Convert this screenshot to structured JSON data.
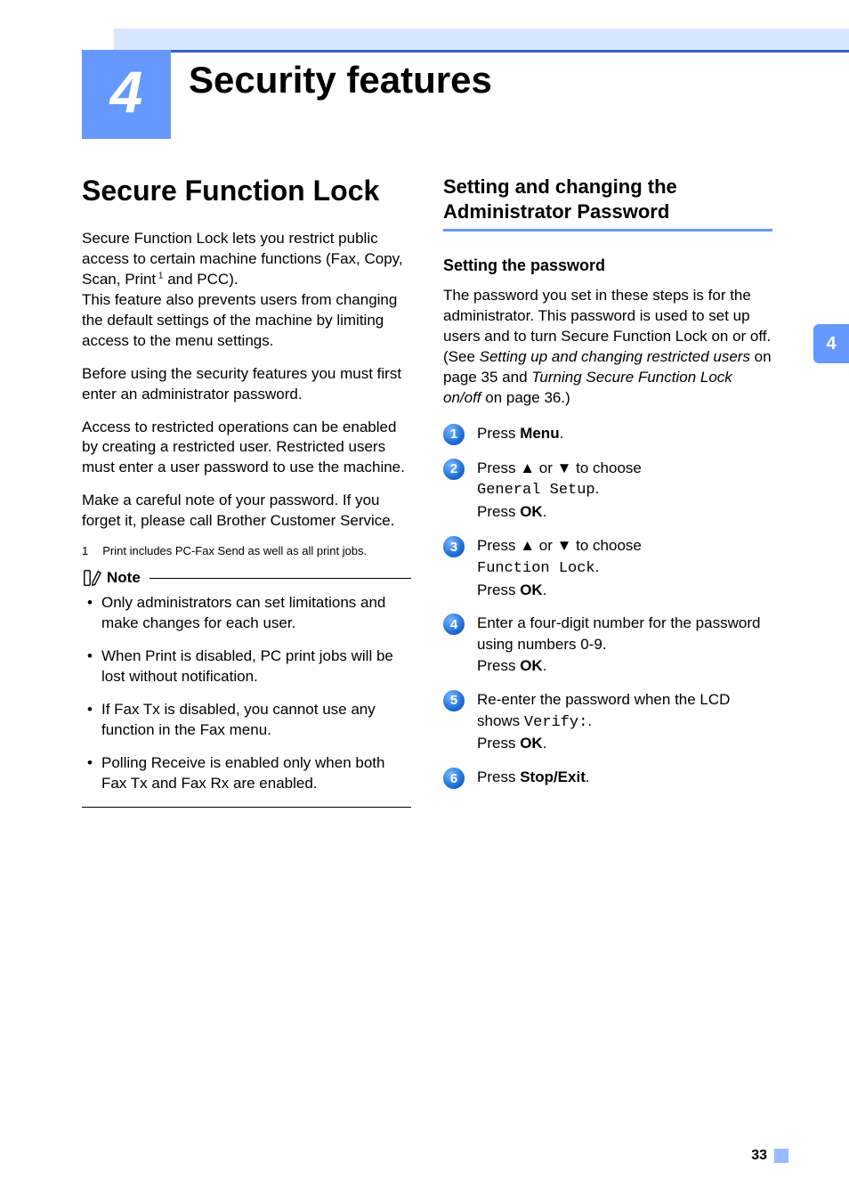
{
  "chapter": {
    "number": "4",
    "title": "Security features"
  },
  "sideTab": "4",
  "pageNumber": "33",
  "left": {
    "heading": "Secure Function Lock",
    "p1a": "Secure Function Lock lets you restrict public access to certain machine functions (Fax, Copy, Scan, Print",
    "p1b": " and PCC).",
    "superscript": " 1",
    "p1c": "This feature also prevents users from changing the default settings of the machine by limiting access to the menu settings.",
    "p2": "Before using the security features you must first enter an administrator password.",
    "p3": "Access to restricted operations can be enabled by creating a restricted user. Restricted users must enter a user password to use the machine.",
    "p4": "Make a careful note of your password. If you forget it, please call Brother Customer Service.",
    "footnoteNum": "1",
    "footnoteText": "Print includes PC-Fax Send as well as all print jobs.",
    "noteLabel": "Note",
    "note1": "Only administrators can set limitations and make changes for each user.",
    "note2": "When Print is disabled, PC print jobs will be lost without notification.",
    "note3": "If Fax Tx is disabled, you cannot use any function in the Fax menu.",
    "note4": "Polling Receive is enabled only when both Fax Tx and Fax Rx are enabled."
  },
  "right": {
    "h2a": "Setting and changing the",
    "h2b": "Administrator Password",
    "h3": "Setting the password",
    "intro_a": "The password you set in these steps is for the administrator. This password is used to set up users and to turn Secure Function Lock on or off. (See ",
    "intro_b": "Setting up and changing restricted users",
    "intro_c": " on page 35 and ",
    "intro_d": "Turning Secure Function Lock on/off",
    "intro_e": " on page 36.)",
    "step1": {
      "num": "1",
      "pre": "Press ",
      "bold": "Menu",
      "post": "."
    },
    "step2": {
      "num": "2",
      "l1a": "Press ",
      "up": "▲",
      "l1b": " or ",
      "down": "▼",
      "l1c": " to choose ",
      "mono": "General Setup",
      "dot": ".",
      "l2a": "Press ",
      "ok": "OK",
      "l2b": "."
    },
    "step3": {
      "num": "3",
      "l1a": "Press ",
      "up": "▲",
      "l1b": " or ",
      "down": "▼",
      "l1c": " to choose ",
      "mono": "Function Lock",
      "dot": ".",
      "l2a": "Press ",
      "ok": "OK",
      "l2b": "."
    },
    "step4": {
      "num": "4",
      "l1": "Enter a four-digit number for the password using numbers 0-9.",
      "l2a": "Press ",
      "ok": "OK",
      "l2b": "."
    },
    "step5": {
      "num": "5",
      "l1a": "Re-enter the password when the LCD shows ",
      "mono": "Verify:",
      "dot": ".",
      "l2a": "Press ",
      "ok": "OK",
      "l2b": "."
    },
    "step6": {
      "num": "6",
      "pre": "Press ",
      "bold": "Stop/Exit",
      "post": "."
    }
  }
}
